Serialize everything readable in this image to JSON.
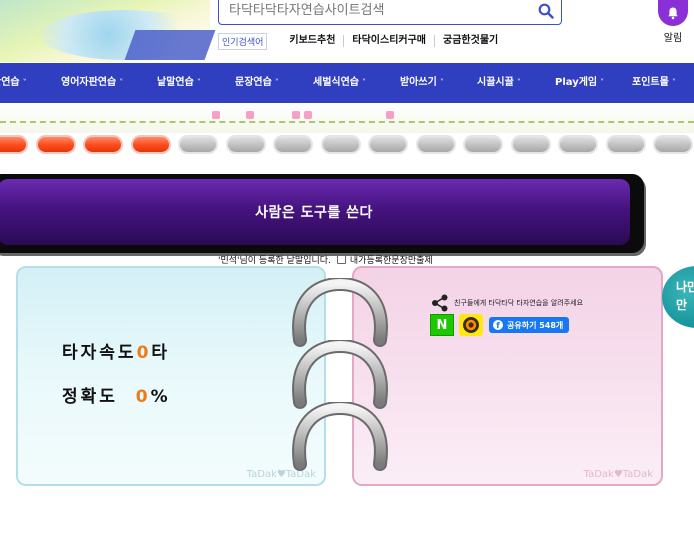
{
  "header": {
    "search_placeholder": "타닥타닥타자연습사이트검색",
    "popular_label": "인기검색어",
    "keywords": [
      "키보드추천",
      "타닥이스티커구매",
      "궁금한것물기"
    ],
    "alarm_label": "알림"
  },
  "nav": {
    "items": [
      {
        "label": "판연습"
      },
      {
        "label": "영어자판연습"
      },
      {
        "label": "낱말연습"
      },
      {
        "label": "문장연습"
      },
      {
        "label": "세벌식연습"
      },
      {
        "label": "받아쓰기"
      },
      {
        "label": "시끌시끌"
      },
      {
        "label": "Play게임"
      },
      {
        "label": "포인트몰"
      }
    ],
    "chevron": "˅"
  },
  "progress": {
    "completed": 4,
    "total": 15
  },
  "practice": {
    "sentence": "사람은 도구를 쓴다",
    "credit_text": "'민석'님이 등록한 낱말입니다.",
    "checkbox_label": "내가등록한문장만출제",
    "checkbox_checked": false
  },
  "stats": {
    "speed_label": "타자속도",
    "speed_value": "0",
    "speed_unit": "타",
    "accuracy_label": "정확도",
    "accuracy_value": "0",
    "accuracy_unit": "%"
  },
  "share": {
    "text": "친구들에게 타닥타닥 타자연습을 알려주세요",
    "naver_label": "N",
    "facebook_label": "공유하기 548개"
  },
  "watermark": "TaDak♥TaDak",
  "side_badge": {
    "line1": "나만",
    "line2": "만"
  },
  "colors": {
    "nav_bg": "#2f3fc0",
    "sentence_bg": "#46137f",
    "accent_number": "#f07a1a",
    "pill_on": "#ff4a1a",
    "pill_off": "#bdbdbd"
  }
}
